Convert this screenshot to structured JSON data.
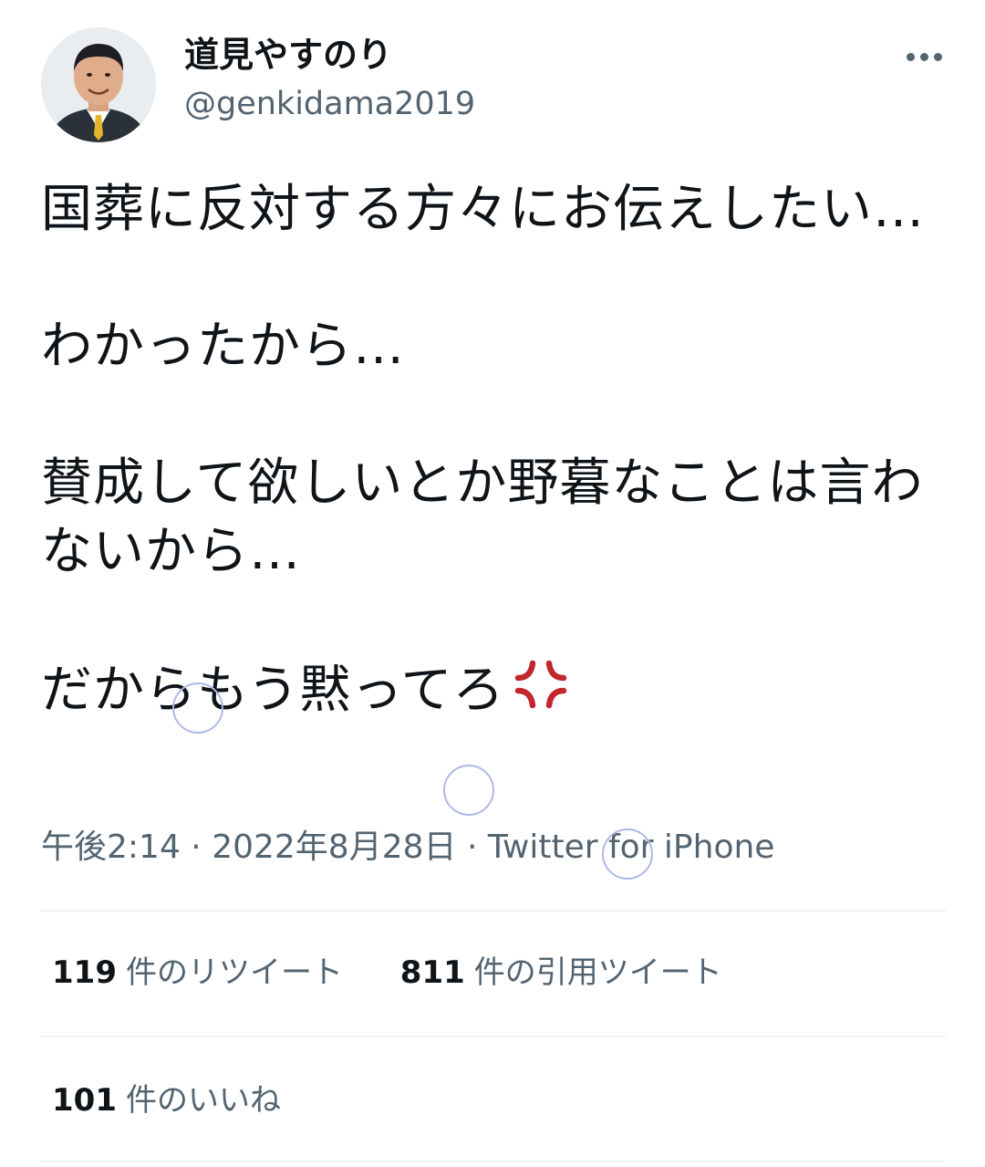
{
  "author": {
    "display_name": "道見やすのり",
    "handle": "@genkidama2019"
  },
  "tweet": {
    "paragraphs": [
      "国葬に反対する方々にお伝えしたい…",
      "わかったから…",
      "賛成して欲しいとか野暮なことは言わないから…",
      "だからもう黙ってろ"
    ],
    "emoji": "anger-symbol-icon"
  },
  "meta": {
    "time": "午後2:14",
    "sep1": " · ",
    "date": "2022年8月28日",
    "sep2": " · ",
    "source": "Twitter for iPhone"
  },
  "stats": {
    "retweets": {
      "count": "119",
      "label": "件のリツイート"
    },
    "quotes": {
      "count": "811",
      "label": "件の引用ツイート"
    },
    "likes": {
      "count": "101",
      "label": "件のいいね"
    }
  },
  "colors": {
    "text": "#0f1419",
    "secondary": "#536471",
    "divider": "#eff3f4",
    "anger": "#c1272d"
  }
}
